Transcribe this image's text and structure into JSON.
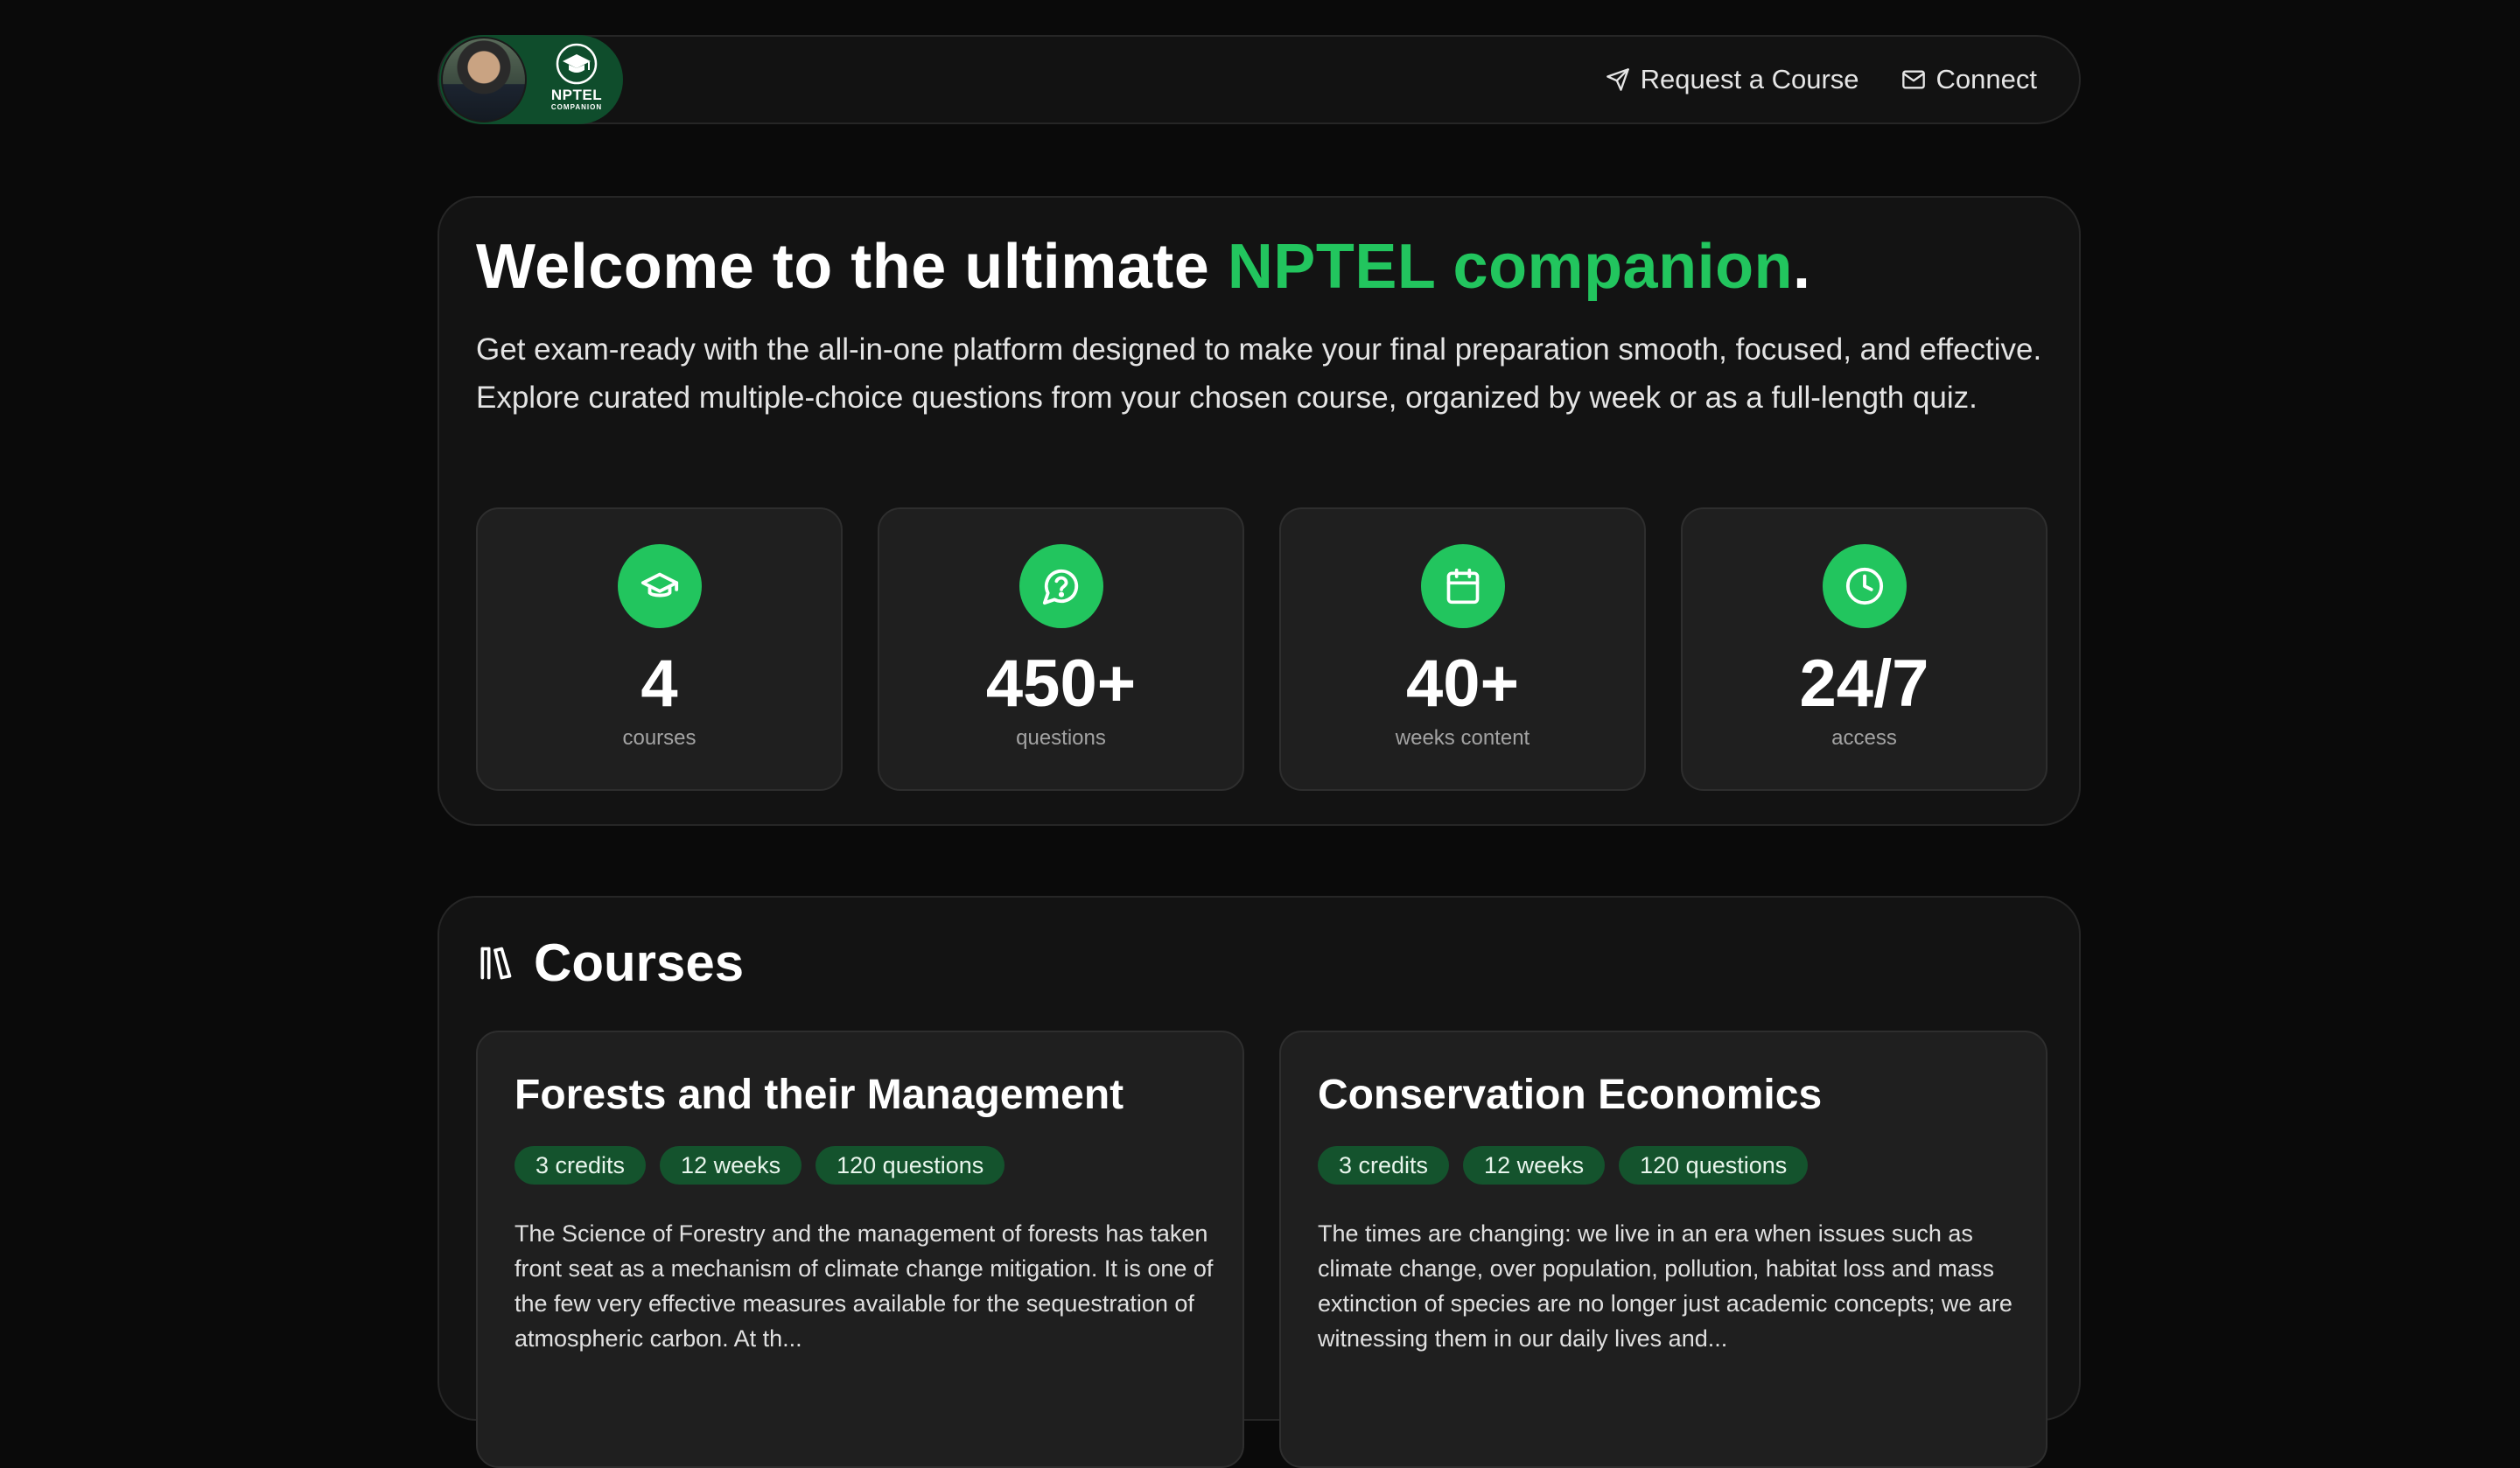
{
  "header": {
    "logo_title": "NPTEL",
    "logo_subtitle": "COMPANION",
    "nav": [
      {
        "label": "Request a Course",
        "icon": "send-icon"
      },
      {
        "label": "Connect",
        "icon": "mail-icon"
      }
    ]
  },
  "hero": {
    "title_prefix": "Welcome to the ultimate ",
    "title_accent": "NPTEL companion",
    "title_suffix": ".",
    "description": "Get exam-ready with the all-in-one platform designed to make your final preparation smooth, focused, and effective. Explore curated multiple-choice questions from your chosen course, organized by week or as a full-length quiz.",
    "stats": [
      {
        "value": "4",
        "label": "courses",
        "icon": "graduation-cap-icon"
      },
      {
        "value": "450+",
        "label": "questions",
        "icon": "question-bubble-icon"
      },
      {
        "value": "40+",
        "label": "weeks content",
        "icon": "calendar-icon"
      },
      {
        "value": "24/7",
        "label": "access",
        "icon": "clock-icon"
      }
    ]
  },
  "courses": {
    "heading": "Courses",
    "items": [
      {
        "title": "Forests and their Management",
        "badges": [
          "3 credits",
          "12 weeks",
          "120 questions"
        ],
        "description": "The Science of Forestry and the management of forests has taken front seat as a mechanism of climate change mitigation. It is one of the few very effective measures available for the sequestration of atmospheric carbon. At th..."
      },
      {
        "title": "Conservation Economics",
        "badges": [
          "3 credits",
          "12 weeks",
          "120 questions"
        ],
        "description": "The times are changing: we live in an era when issues such as climate change, over population, pollution, habitat loss and mass extinction of species are no longer just academic concepts; we are witnessing them in our daily lives and..."
      }
    ]
  },
  "colors": {
    "accent": "#22c55e",
    "badge_bg": "#14532d",
    "background": "#0a0a0a",
    "card": "#1f1f1f"
  }
}
